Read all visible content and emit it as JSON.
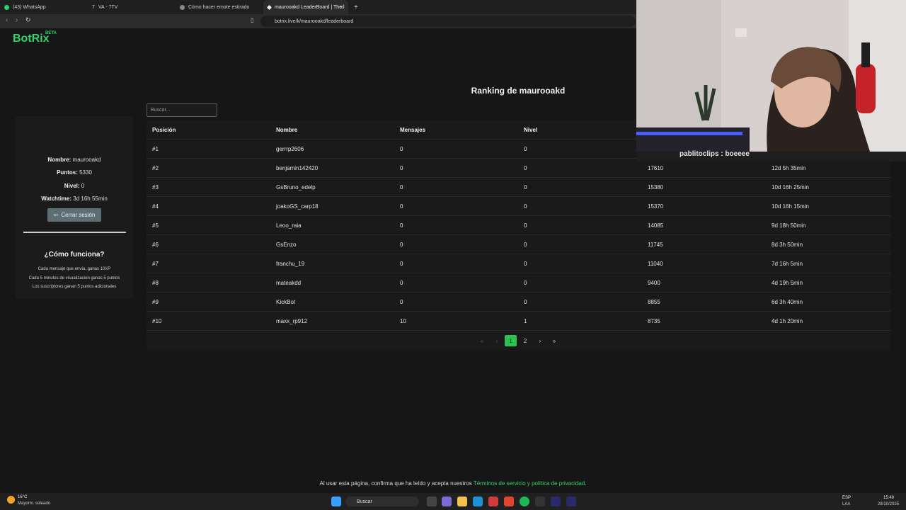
{
  "browser": {
    "tabs": [
      {
        "label": "(43) WhatsApp",
        "active": false
      },
      {
        "label": "VA - 7TV",
        "active": false
      },
      {
        "label": "Cómo hacer emote estirado",
        "active": false
      },
      {
        "label": "maurooakd LeaderBoard | The l",
        "active": true
      }
    ],
    "new_tab": "+",
    "url": "botrix.live/k/maurooakd/leaderboard"
  },
  "site": {
    "logo": "BotRix",
    "badge": "BETA"
  },
  "title": "Ranking de maurooakd",
  "search": {
    "placeholder": "Buscar..."
  },
  "profile": {
    "name_label": "Nombre:",
    "name_value": "maurooakd",
    "points_label": "Puntos:",
    "points_value": "5330",
    "level_label": "Nivel:",
    "level_value": "0",
    "watchtime_label": "Watchtime:",
    "watchtime_value": "3d 16h 55min",
    "logout_label": "Cerrar sesión"
  },
  "how": {
    "title": "¿Cómo funciona?",
    "lines": [
      "Cada mensaje que envía, ganas 10XP",
      "Cada 5 minutos de visualizacion ganas 5 puntos",
      "Los suscriptores ganan 5 puntos adicionales"
    ]
  },
  "table": {
    "headers": [
      "Posición",
      "Nombre",
      "Mensajes",
      "Nivel",
      "",
      ""
    ],
    "rows": [
      [
        "#1",
        "gerrrp2606",
        "0",
        "0",
        "",
        ""
      ],
      [
        "#2",
        "benjamin142420",
        "0",
        "0",
        "17610",
        "12d 5h 35min"
      ],
      [
        "#3",
        "GsBruno_edelp",
        "0",
        "0",
        "15380",
        "10d 16h 25min"
      ],
      [
        "#4",
        "joakoGS_carp18",
        "0",
        "0",
        "15370",
        "10d 16h 15min"
      ],
      [
        "#5",
        "Leoo_raia",
        "0",
        "0",
        "14085",
        "9d 18h 50min"
      ],
      [
        "#6",
        "GsEnzo",
        "0",
        "0",
        "11745",
        "8d 3h 50min"
      ],
      [
        "#7",
        "franchu_19",
        "0",
        "0",
        "11040",
        "7d 16h 5min"
      ],
      [
        "#8",
        "mateakdd",
        "0",
        "0",
        "9400",
        "4d 19h 5min"
      ],
      [
        "#9",
        "KickBot",
        "0",
        "0",
        "8855",
        "6d 3h 40min"
      ],
      [
        "#10",
        "maxx_rp912",
        "10",
        "1",
        "8735",
        "4d 1h 20min"
      ]
    ]
  },
  "pagination": {
    "first": "«",
    "prev": "‹",
    "current": "1",
    "next_page": "2",
    "next": "›",
    "last": "»"
  },
  "legal": {
    "text": "Al usar esta página, confirma que ha leído y acepta nuestros ",
    "link": "Términos de servicio y política de privacidad",
    "end": "."
  },
  "chat_overlay": "pablitoclips : boeeee",
  "taskbar": {
    "weather_temp": "16°C",
    "weather_desc": "Mayorm. soleado",
    "search": "Buscar",
    "lang1": "ESP",
    "lang2": "LAA",
    "time": "15:49",
    "date": "28/10/2025"
  },
  "colors": {
    "accent": "#32d46a",
    "page_bg": "#161616",
    "panel_bg": "#1a1a1a"
  }
}
